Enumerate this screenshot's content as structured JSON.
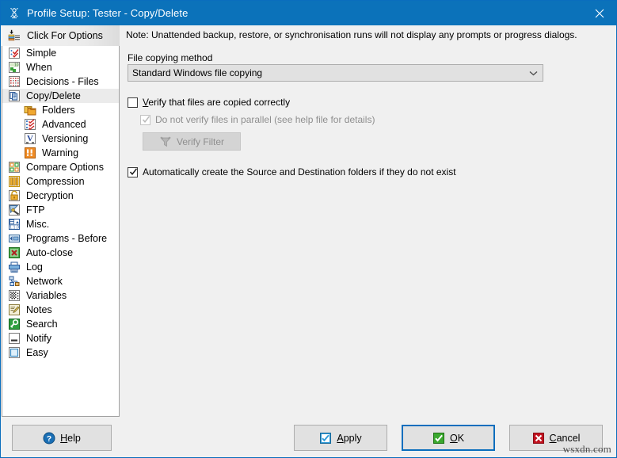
{
  "window": {
    "title": "Profile Setup: Tester - Copy/Delete",
    "title_icon": "profile-setup-icon",
    "close_icon": "close-icon",
    "titlebar_color": "#0b72ba",
    "border_color": "#0a6ebd",
    "watermark": "wsxdn.com"
  },
  "sidebar": {
    "header": {
      "label": "Click For Options",
      "icon": "options-stack-icon"
    },
    "items": [
      {
        "label": "Simple",
        "icon": "simple-icon",
        "indent": false,
        "selected": false
      },
      {
        "label": "When",
        "icon": "when-icon",
        "indent": false,
        "selected": false
      },
      {
        "label": "Decisions - Files",
        "icon": "decisions-files-icon",
        "indent": false,
        "selected": false
      },
      {
        "label": "Copy/Delete",
        "icon": "copy-delete-icon",
        "indent": false,
        "selected": true
      },
      {
        "label": "Folders",
        "icon": "folders-icon",
        "indent": true,
        "selected": false
      },
      {
        "label": "Advanced",
        "icon": "advanced-icon",
        "indent": true,
        "selected": false
      },
      {
        "label": "Versioning",
        "icon": "versioning-icon",
        "indent": true,
        "selected": false
      },
      {
        "label": "Warning",
        "icon": "warning-icon",
        "indent": true,
        "selected": false
      },
      {
        "label": "Compare Options",
        "icon": "compare-options-icon",
        "indent": false,
        "selected": false
      },
      {
        "label": "Compression",
        "icon": "compression-icon",
        "indent": false,
        "selected": false
      },
      {
        "label": "Decryption",
        "icon": "decryption-icon",
        "indent": false,
        "selected": false
      },
      {
        "label": "FTP",
        "icon": "ftp-icon",
        "indent": false,
        "selected": false
      },
      {
        "label": "Misc.",
        "icon": "misc-icon",
        "indent": false,
        "selected": false
      },
      {
        "label": "Programs - Before",
        "icon": "programs-before-icon",
        "indent": false,
        "selected": false
      },
      {
        "label": "Auto-close",
        "icon": "auto-close-icon",
        "indent": false,
        "selected": false
      },
      {
        "label": "Log",
        "icon": "log-icon",
        "indent": false,
        "selected": false
      },
      {
        "label": "Network",
        "icon": "network-icon",
        "indent": false,
        "selected": false
      },
      {
        "label": "Variables",
        "icon": "variables-icon",
        "indent": false,
        "selected": false
      },
      {
        "label": "Notes",
        "icon": "notes-icon",
        "indent": false,
        "selected": false
      },
      {
        "label": "Search",
        "icon": "search-icon",
        "indent": false,
        "selected": false
      },
      {
        "label": "Notify",
        "icon": "notify-icon",
        "indent": false,
        "selected": false
      },
      {
        "label": "Easy",
        "icon": "easy-icon",
        "indent": false,
        "selected": false
      }
    ]
  },
  "main": {
    "note": "Note: Unattended backup, restore, or synchronisation runs will not display any prompts or progress dialogs.",
    "copy_method": {
      "label": "File copying method",
      "value": "Standard Windows file copying",
      "arrow_icon": "chevron-down-icon"
    },
    "verify": {
      "label_accesskey": "V",
      "label_rest": "erify that files are copied correctly",
      "checked": false
    },
    "parallel": {
      "label": "Do not verify files in parallel (see help file for details)",
      "checked": true,
      "disabled": true
    },
    "verify_filter": {
      "label": "Verify Filter",
      "icon": "filter-icon",
      "disabled": true
    },
    "auto_create": {
      "label": "Automatically create the Source and Destination folders if they do not exist",
      "checked": true
    }
  },
  "buttons": {
    "help": {
      "accesskey": "H",
      "rest": "elp",
      "icon": "help-icon"
    },
    "apply": {
      "accesskey": "A",
      "rest": "pply",
      "icon": "apply-icon"
    },
    "ok": {
      "accesskey": "O",
      "rest": "K",
      "icon": "ok-check-icon",
      "default": true
    },
    "cancel": {
      "accesskey": "C",
      "rest": "ancel",
      "icon": "cancel-x-icon"
    }
  }
}
